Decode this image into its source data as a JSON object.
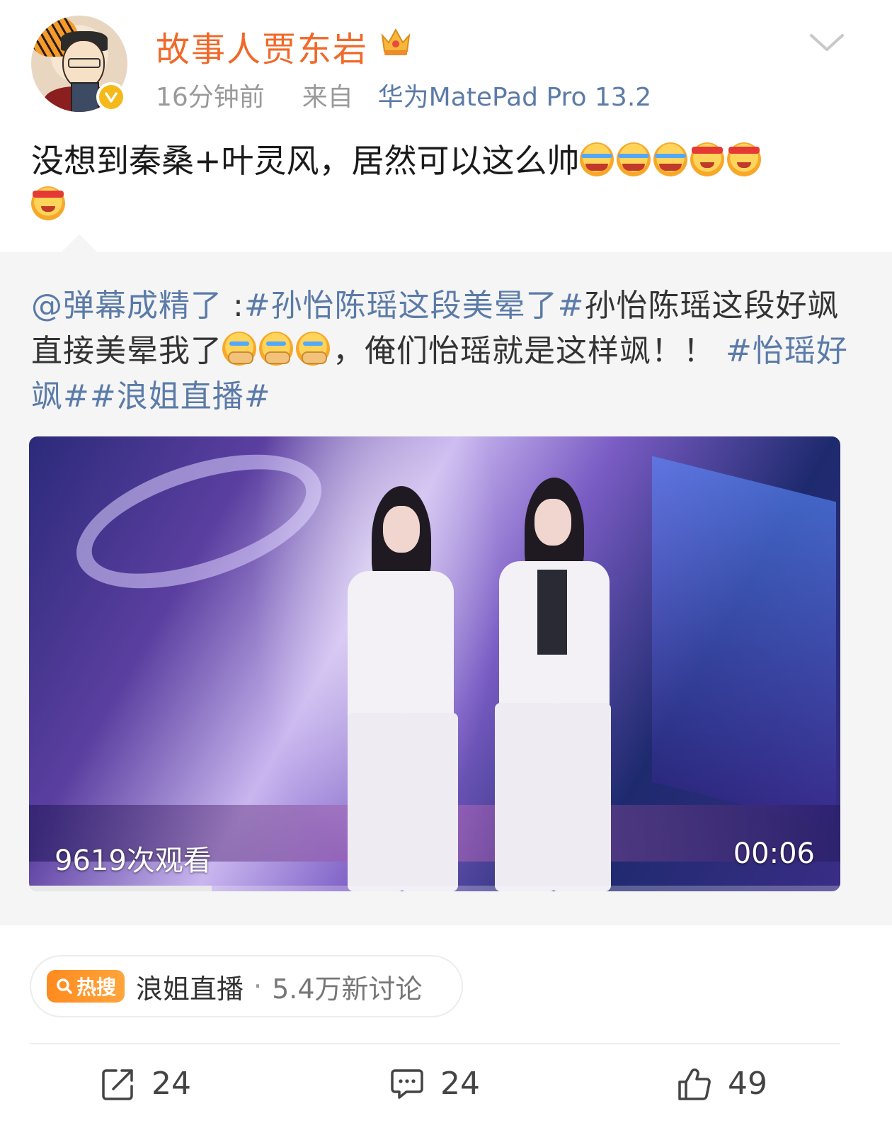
{
  "post": {
    "username": "故事人贾东岩",
    "time": "16分钟前",
    "source_prefix": "来自",
    "source_device": "华为MatePad Pro 13.2",
    "text": "没想到秦桑+叶灵风，居然可以这么帅",
    "emojis": [
      "cry-laugh",
      "cry-laugh",
      "cry-laugh",
      "headband-smile",
      "headband-smile",
      "headband-smile"
    ]
  },
  "repost": {
    "mention": "@弹幕成精了",
    "colon": " :",
    "hashtag1": "#孙怡陈瑶这段美晕了#",
    "text1": "孙怡陈瑶这段好飒直接美晕我了",
    "text2": "，俺们怡瑶就是这样飒！！",
    "hashtag2": "#怡瑶好飒#",
    "hashtag3": "#浪姐直播#",
    "emojis": [
      "sob",
      "sob",
      "sob"
    ],
    "video": {
      "views": "9619次观看",
      "duration": "00:06",
      "progress_fraction": 0.225
    }
  },
  "hot_search": {
    "badge": "热搜",
    "topic": "浪姐直播",
    "separator": "·",
    "discussion": "5.4万新讨论"
  },
  "actions": {
    "repost_count": "24",
    "comment_count": "24",
    "like_count": "49"
  },
  "colors": {
    "username": "#f0692a",
    "link": "#5b7ba8",
    "hot_badge": "#ff8a1f",
    "verified": "#f5b919"
  }
}
